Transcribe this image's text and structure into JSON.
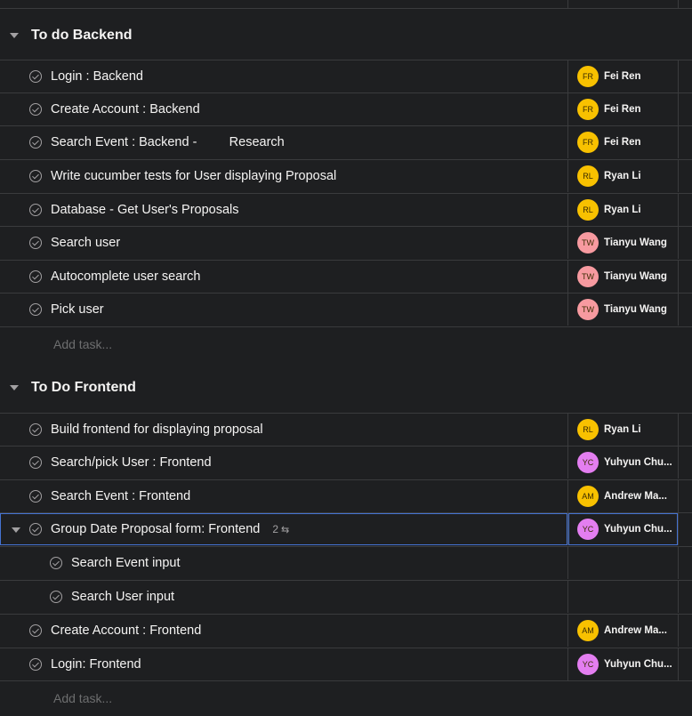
{
  "colors": {
    "background": "#1e1f21",
    "border": "#3a3b3d",
    "selected_border": "#4573d2",
    "avatar_fr": "#f8c100",
    "avatar_rl": "#f8c100",
    "avatar_tw": "#f79aa0",
    "avatar_yc": "#e37ef0",
    "avatar_am": "#f8c100"
  },
  "sections": [
    {
      "title": "To do Backend",
      "add_task": "Add task...",
      "tasks": [
        {
          "name": "Login : Backend",
          "initials": "FR",
          "assignee": "Fei Ren"
        },
        {
          "name": "Create Account : Backend",
          "initials": "FR",
          "assignee": "Fei Ren"
        },
        {
          "name": "Search Event : Backend -         Research",
          "initials": "FR",
          "assignee": "Fei Ren"
        },
        {
          "name": "Write cucumber tests for User displaying Proposal",
          "initials": "RL",
          "assignee": "Ryan Li"
        },
        {
          "name": "Database - Get User's Proposals",
          "initials": "RL",
          "assignee": "Ryan Li"
        },
        {
          "name": "Search user",
          "initials": "TW",
          "assignee": "Tianyu Wang"
        },
        {
          "name": "Autocomplete user search",
          "initials": "TW",
          "assignee": "Tianyu Wang"
        },
        {
          "name": "Pick user",
          "initials": "TW",
          "assignee": "Tianyu Wang"
        }
      ]
    },
    {
      "title": "To Do Frontend",
      "add_task": "Add task...",
      "tasks": [
        {
          "name": "Build frontend for displaying proposal",
          "initials": "RL",
          "assignee": "Ryan Li"
        },
        {
          "name": "Search/pick User : Frontend",
          "initials": "YC",
          "assignee": "Yuhyun Chu..."
        },
        {
          "name": "Search Event : Frontend",
          "initials": "AM",
          "assignee": "Andrew Ma..."
        },
        {
          "name": "Group Date Proposal form: Frontend",
          "initials": "YC",
          "assignee": "Yuhyun Chu...",
          "subtask_count": "2"
        },
        {
          "name": "Search Event input"
        },
        {
          "name": "Search User input"
        },
        {
          "name": "Create Account : Frontend",
          "initials": "AM",
          "assignee": "Andrew Ma..."
        },
        {
          "name": "Login: Frontend",
          "initials": "YC",
          "assignee": "Yuhyun Chu..."
        }
      ]
    }
  ]
}
